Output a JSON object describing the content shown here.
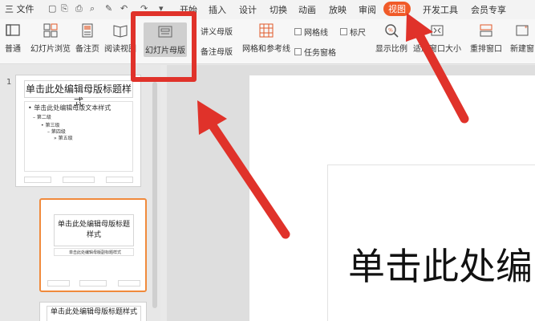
{
  "menubar": {
    "file_label": "三 文件",
    "tabs": [
      "开始",
      "插入",
      "设计",
      "切换",
      "动画",
      "放映",
      "审阅",
      "视图",
      "开发工具",
      "会员专享"
    ],
    "active_tab": "视图"
  },
  "ribbon": {
    "normal": "普通",
    "slide_browse": "幻灯片浏览",
    "notes_page": "备注页",
    "reading_view": "阅读视图",
    "slide_master": "幻灯片母版",
    "handout_master": "讲义母版",
    "notes_master": "备注母版",
    "grid_guides": "网格和参考线",
    "gridlines": "网格线",
    "ruler": "标尺",
    "task_pane": "任务窗格",
    "zoom": "显示比例",
    "fit_window": "适应窗口大小",
    "arrange_window": "重排窗口",
    "new_window": "新建窗"
  },
  "thumbnails": {
    "number": "1",
    "master_title": "单击此处编辑母版标题样式",
    "body_lines": [
      "• 单击此处编辑母版文本样式",
      "– 第二级",
      "• 第三级",
      "– 第四级",
      "» 第五级"
    ],
    "layout_title": "单击此处编辑母版标题样式",
    "layout_subtitle": "单击此处编辑母版副标题样式",
    "third_title": "单击此处编辑母版标题样式"
  },
  "canvas": {
    "title_text": "单击此处编"
  },
  "colors": {
    "accent": "#f05a28",
    "annotation_red": "#e0322a"
  }
}
